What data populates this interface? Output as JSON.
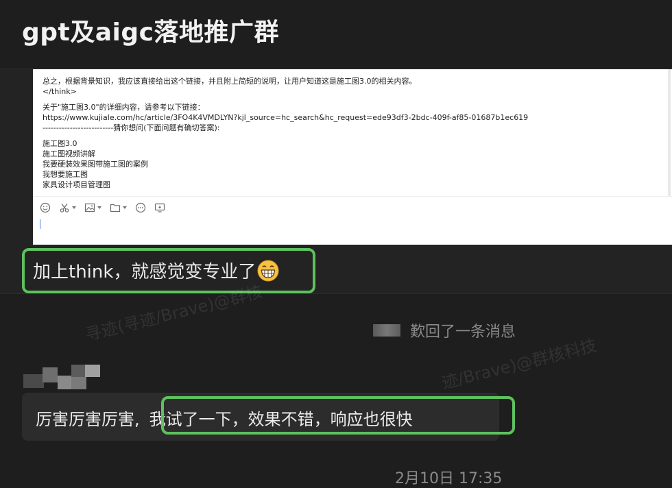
{
  "header": {
    "title": "gpt及aigc落地推广群"
  },
  "screenshot": {
    "lines": [
      "总之，根据背景知识，我应该直接给出这个链接，并且附上简短的说明，让用户知道这是施工图3.0的相关内容。",
      "</think>",
      "",
      "关于\"施工图3.0\"的详细内容，请参考以下链接：",
      "https://www.kujiale.com/hc/article/3FO4K4VMDLYN?kjl_source=hc_search&hc_request=ede93df3-2bdc-409f-af85-01687b1ec619",
      "--------------------------猜你想问(下面问题有确切答案):",
      "",
      "施工图3.0",
      "施工图视频讲解",
      "我要硬装效果图带施工图的案例",
      "我想要施工图",
      "家具设计项目管理图"
    ],
    "toolbar": [
      "emoji-icon",
      "scissors-icon",
      "image-icon",
      "folder-icon",
      "more-icon",
      "screen-icon"
    ]
  },
  "messages": {
    "think_comment": "加上think，就感觉变专业了",
    "recall_notice": "歎回了一条消息",
    "reply_part1": "厉害厉害厉害,",
    "reply_part2": "我试了一下，效果不错，响应也很快",
    "timestamp": "2月10日 17:35"
  },
  "watermarks": [
    "寻迹(寻迹/Brave)@群核",
    "寻迹(寻迹/Brave)@群核科技",
    "迹/Brave)@群核科技"
  ],
  "colors": {
    "highlight": "#5ec15e",
    "background": "#1e1e1e",
    "bubble": "#2c2c2c"
  }
}
